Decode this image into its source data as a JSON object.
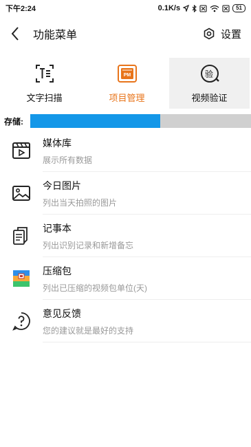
{
  "status_bar": {
    "time": "下午2:24",
    "speed": "0.1K/s",
    "battery": "51"
  },
  "header": {
    "title": "功能菜单",
    "settings_label": "设置"
  },
  "features": [
    {
      "label": "文字扫描",
      "icon": "text-scan-icon",
      "color": "#111111"
    },
    {
      "label": "项目管理",
      "icon": "project-pm-icon",
      "color": "#e8741a"
    },
    {
      "label": "视频验证",
      "icon": "video-verify-icon",
      "color": "#111111"
    }
  ],
  "storage": {
    "label": "存储:",
    "used_fraction": 0.59,
    "fill_color": "#1497e8",
    "track_color": "#d0d0d0"
  },
  "menu": [
    {
      "title": "媒体库",
      "subtitle": "展示所有数据",
      "icon": "media-library-icon"
    },
    {
      "title": "今日图片",
      "subtitle": "列出当天拍照的图片",
      "icon": "image-icon"
    },
    {
      "title": "记事本",
      "subtitle": "列出识别记录和新增备忘",
      "icon": "notepad-icon"
    },
    {
      "title": "压缩包",
      "subtitle": "列出已压缩的视频包单位(天)",
      "icon": "archive-icon"
    },
    {
      "title": "意见反馈",
      "subtitle": "您的建议就是最好的支持",
      "icon": "feedback-icon"
    }
  ]
}
